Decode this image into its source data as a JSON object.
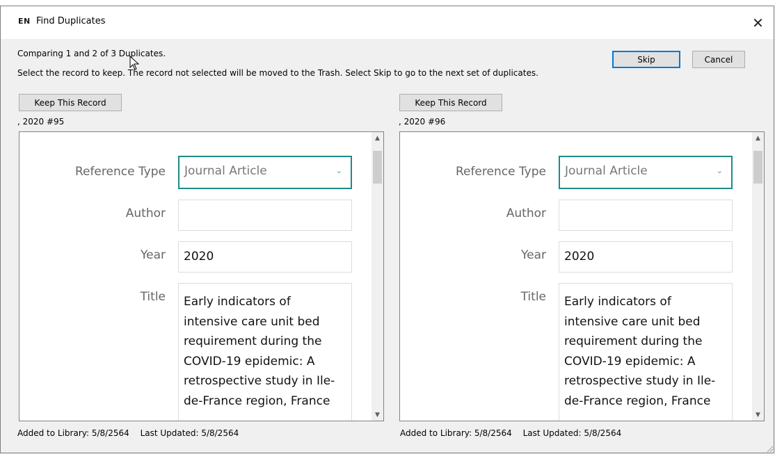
{
  "window": {
    "app_icon": "EN",
    "title": "Find Duplicates",
    "close_symbol": "✕"
  },
  "message": {
    "line1": "Comparing 1 and 2 of 3 Duplicates.",
    "line2": "Select the record to keep. The record not selected will be moved to the Trash. Select Skip to go to the next set of duplicates."
  },
  "buttons": {
    "skip": "Skip",
    "cancel": "Cancel"
  },
  "records": [
    {
      "keep_label": "Keep This Record",
      "header": ", 2020 #95",
      "fields": {
        "reference_type_label": "Reference Type",
        "reference_type_value": "Journal Article",
        "author_label": "Author",
        "author_value": "",
        "year_label": "Year",
        "year_value": "2020",
        "title_label": "Title",
        "title_value": "Early indicators of intensive care unit bed requirement during the COVID-19 epidemic: A retrospective study in Ile-de-France region, France"
      },
      "footer": {
        "added": "Added to Library: 5/8/2564",
        "updated": "Last Updated: 5/8/2564"
      }
    },
    {
      "keep_label": "Keep This Record",
      "header": ", 2020 #96",
      "fields": {
        "reference_type_label": "Reference Type",
        "reference_type_value": "Journal Article",
        "author_label": "Author",
        "author_value": "",
        "year_label": "Year",
        "year_value": "2020",
        "title_label": "Title",
        "title_value": "Early indicators of intensive care unit bed requirement during the COVID-19 epidemic: A retrospective study in Ile-de-France region, France"
      },
      "footer": {
        "added": "Added to Library: 5/8/2564",
        "updated": "Last Updated: 5/8/2564"
      }
    }
  ],
  "icons": {
    "chevron": "chevron-down-icon",
    "scroll_up": "scroll-up-icon",
    "scroll_down": "scroll-down-icon",
    "cursor": "mouse-cursor-icon",
    "grip": "resize-grip-icon"
  },
  "colors": {
    "focus_border": "#1f8a8a",
    "default_button_border": "#0078d7",
    "label_gray": "#666666"
  }
}
